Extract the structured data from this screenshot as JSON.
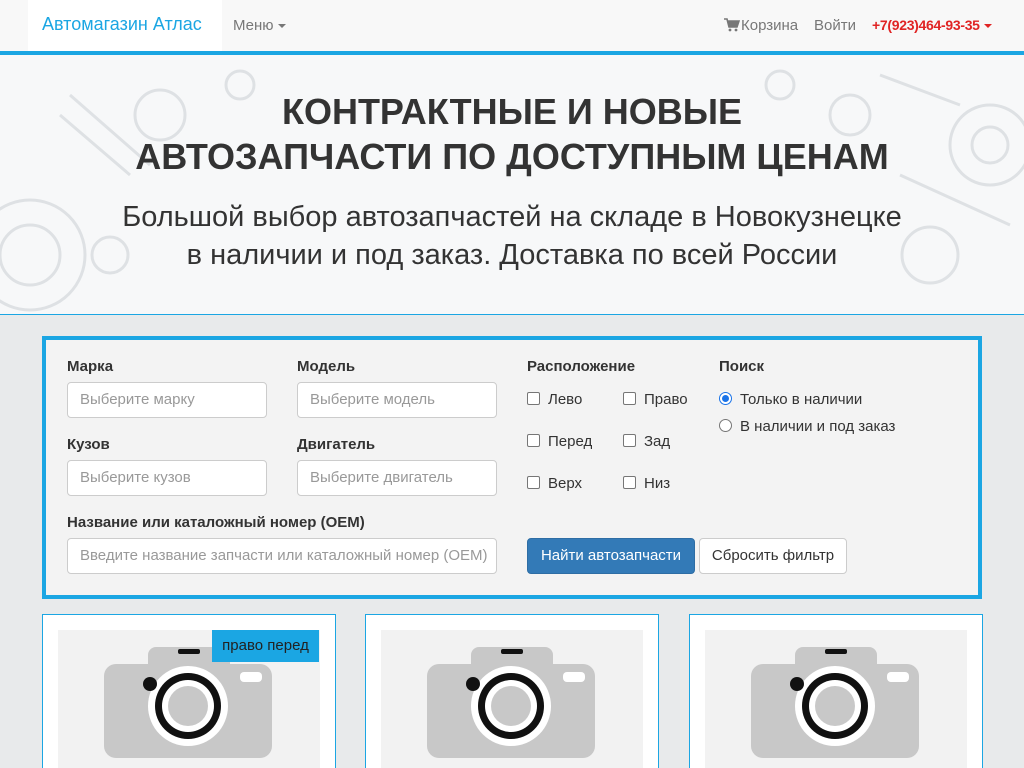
{
  "navbar": {
    "brand": "Автомагазин Атлас",
    "menu_label": "Меню",
    "cart_label": "Корзина",
    "login_label": "Войти",
    "phone": "+7(923)464-93-35"
  },
  "hero": {
    "title_line1": "КОНТРАКТНЫЕ И НОВЫЕ",
    "title_line2": "АВТОЗАПЧАСТИ ПО ДОСТУПНЫМ ЦЕНАМ",
    "subtitle_line1": "Большой выбор автозапчастей на складе в Новокузнецке",
    "subtitle_line2": "в наличии и под заказ. Доставка по всей России"
  },
  "filter": {
    "make_label": "Марка",
    "make_placeholder": "Выберите марку",
    "model_label": "Модель",
    "model_placeholder": "Выберите модель",
    "body_label": "Кузов",
    "body_placeholder": "Выберите кузов",
    "engine_label": "Двигатель",
    "engine_placeholder": "Выберите двигатель",
    "oem_label": "Название или каталожный номер (OEM)",
    "oem_placeholder": "Введите название запчасти или каталожный номер (OEM)",
    "location_label": "Расположение",
    "location_options": [
      "Лево",
      "Право",
      "Перед",
      "Зад",
      "Верх",
      "Низ"
    ],
    "search_label": "Поиск",
    "search_options": [
      "Только в наличии",
      "В наличии и под заказ"
    ],
    "search_selected": "Только в наличии",
    "submit_label": "Найти автозапчасти",
    "reset_label": "Сбросить фильтр"
  },
  "products": [
    {
      "badge": "право перед"
    },
    {
      "badge": ""
    },
    {
      "badge": ""
    }
  ],
  "colors": {
    "accent": "#1ba6e3",
    "primary_button": "#337ab7",
    "phone": "#e02424"
  }
}
